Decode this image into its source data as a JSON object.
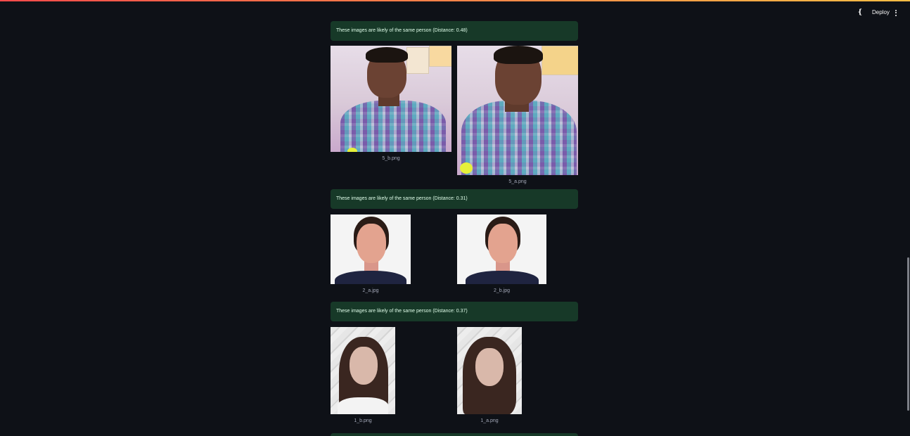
{
  "header": {
    "run_icon": "streamlit-running-icon",
    "deploy_label": "Deploy",
    "menu_icon": "more-vertical-icon"
  },
  "colors": {
    "background": "#0e1117",
    "success_bg": "#173928",
    "success_text": "#dffde9",
    "caption": "#a3a8b8"
  },
  "results": [
    {
      "message": "These images are likely of the same person (Distance: 0.48)",
      "left_caption": "5_b.png",
      "right_caption": "5_a.png"
    },
    {
      "message": "These images are likely of the same person (Distance: 0.31)",
      "left_caption": "2_a.jpg",
      "right_caption": "2_b.jpg"
    },
    {
      "message": "These images are likely of the same person (Distance: 0.37)",
      "left_caption": "1_b.png",
      "right_caption": "1_a.png"
    }
  ]
}
